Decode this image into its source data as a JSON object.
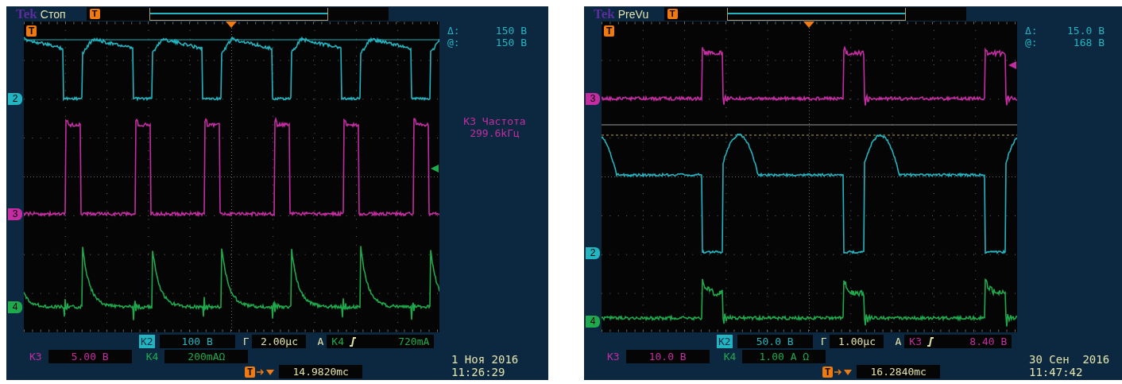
{
  "scopes": [
    {
      "logo": "Tek",
      "status": "Стоп",
      "header_flag": "T",
      "plot_flag": "T",
      "channels": [
        {
          "marker": "2",
          "color": "#22b4c0"
        },
        {
          "marker": "3",
          "color": "#c42da2"
        },
        {
          "marker": "4",
          "color": "#1eaa4c"
        }
      ],
      "cursors": [
        {
          "label": "Δ:",
          "value": "150 B"
        },
        {
          "label": "@:",
          "value": "150 B"
        }
      ],
      "measurement": {
        "label": "K3 Частота",
        "value": "299.6kГц"
      },
      "vertical": [
        {
          "label": "K2",
          "value": "100 B",
          "selected": true,
          "color": "#22b4c0"
        },
        {
          "label": "K3",
          "value": "5.00 B",
          "selected": false,
          "color": "#c42da2"
        },
        {
          "label": "K4",
          "value": "200mAΩ",
          "selected": false,
          "color": "#1eaa4c"
        }
      ],
      "timebase": {
        "label": "Г",
        "value": "2.00µc"
      },
      "trigger": {
        "mode": "A",
        "source": "K4",
        "level": "720mA",
        "color": "#1eaa4c"
      },
      "position": {
        "flag": "T",
        "value": "14.9820mc"
      },
      "date": "1 Ноя 2016",
      "time": "11:26:29"
    },
    {
      "logo": "Tek",
      "status": "PreVu",
      "header_flag": "T",
      "plot_flag": "T",
      "channels": [
        {
          "marker": "3",
          "color": "#c42da2"
        },
        {
          "marker": "2",
          "color": "#22b4c0"
        },
        {
          "marker": "4",
          "color": "#1eaa4c"
        }
      ],
      "cursors": [
        {
          "label": "Δ:",
          "value": "15.0 B"
        },
        {
          "label": "@:",
          "value": "168 B"
        }
      ],
      "vertical": [
        {
          "label": "K2",
          "value": "50.0 B",
          "selected": true,
          "color": "#22b4c0"
        },
        {
          "label": "K3",
          "value": "10.0 B",
          "selected": false,
          "color": "#c42da2"
        },
        {
          "label": "K4",
          "value": "1.00 A Ω",
          "selected": false,
          "color": "#1eaa4c"
        }
      ],
      "timebase": {
        "label": "Г",
        "value": "1.00µc"
      },
      "trigger": {
        "mode": "A",
        "source": "K3",
        "level": "8.40 B",
        "color": "#c42da2"
      },
      "position": {
        "flag": "T",
        "value": "16.2840mc"
      },
      "date": "30 Сен  2016",
      "time": "11:47:42"
    }
  ]
}
